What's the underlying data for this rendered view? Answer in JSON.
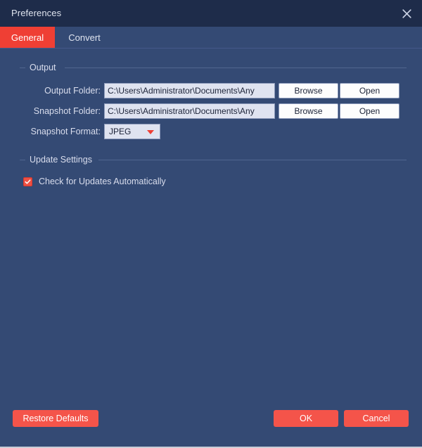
{
  "window": {
    "title": "Preferences",
    "close_icon": "close-icon"
  },
  "tabs": [
    {
      "label": "General",
      "active": true
    },
    {
      "label": "Convert",
      "active": false
    }
  ],
  "groups": {
    "output": {
      "title": "Output",
      "rows": [
        {
          "label": "Output Folder:",
          "value": "C:\\Users\\Administrator\\Documents\\Any",
          "placeholder": "C:\\Users\\Administrator\\Documents\\Any",
          "browse_label": "Browse",
          "open_label": "Open"
        },
        {
          "label": "Snapshot Folder:",
          "value": "C:\\Users\\Administrator\\Documents\\Any",
          "placeholder": "C:\\Users\\Administrator\\Documents\\Any",
          "browse_label": "Browse",
          "open_label": "Open"
        }
      ],
      "format": {
        "label": "Snapshot Format:",
        "value": "JPEG",
        "arrow_icon": "chevron-down-icon"
      }
    },
    "update": {
      "title": "Update Settings",
      "checkbox": {
        "label": "Check for Updates Automatically",
        "checked": true,
        "check_icon": "checkmark-icon"
      }
    }
  },
  "footer": {
    "restore_defaults_label": "Restore Defaults",
    "ok_label": "OK",
    "cancel_label": "Cancel"
  },
  "colors": {
    "titlebar": "#1e2c4a",
    "body": "#344a74",
    "accent": "#ef3f34",
    "accent_button": "#f4544a",
    "input_background": "#dfe3f0",
    "text": "#d9dded"
  }
}
